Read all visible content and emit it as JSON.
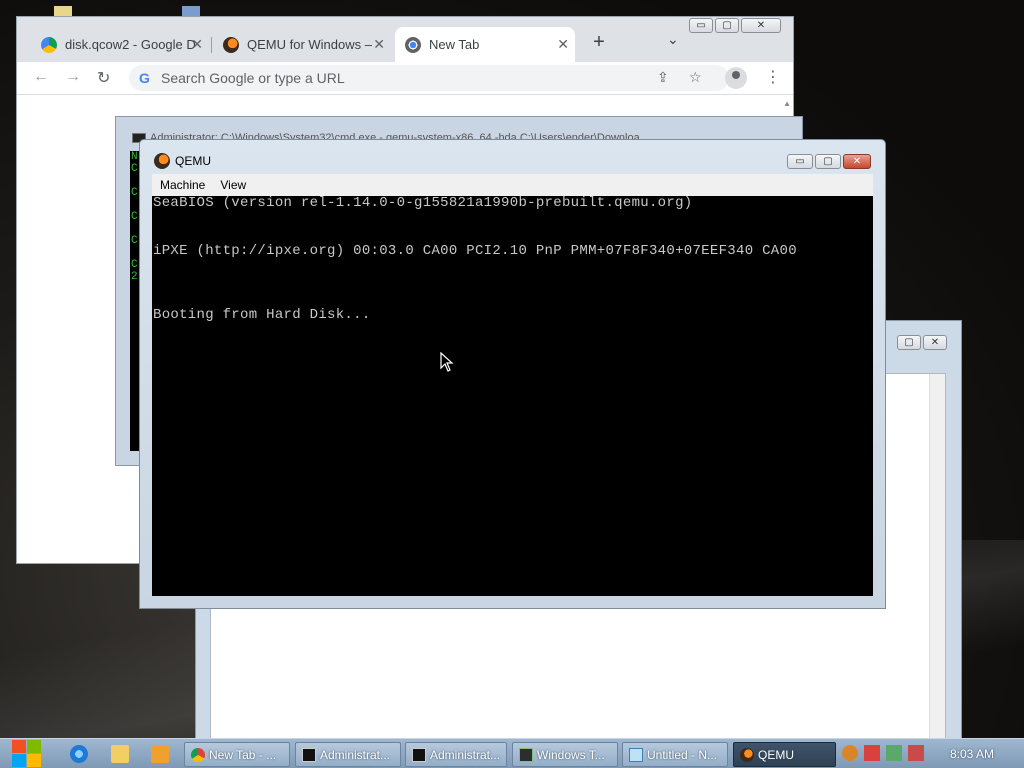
{
  "chrome": {
    "tabs": [
      {
        "label": "disk.qcow2 - Google D",
        "icon": "google-drive-icon",
        "close": "✕"
      },
      {
        "label": "QEMU for Windows –",
        "icon": "qemu-icon",
        "close": "✕"
      },
      {
        "label": "New Tab",
        "icon": "chrome-icon",
        "close": "✕",
        "active": true
      }
    ],
    "new_tab_glyph": "+",
    "tab_search_glyph": "⌄",
    "omnibox_placeholder": "Search Google or type a URL",
    "omnibox_badge": "G",
    "nav": {
      "back": "←",
      "forward": "→",
      "reload": "↻"
    },
    "share_glyph": "⇪",
    "bookmark_glyph": "☆",
    "menu_glyph": "⋮",
    "window_buttons": {
      "min": "▭",
      "max": "▢",
      "close": "✕"
    }
  },
  "cmd": {
    "title": "Administrator: C:\\Windows\\System32\\cmd.exe - qemu-system-x86_64 -hda C:\\Users\\ender\\Downloa",
    "visible_chars": [
      "N",
      "C",
      "",
      "C",
      "",
      "C",
      "",
      "C",
      "",
      "C",
      "2"
    ]
  },
  "qemu": {
    "title": "QEMU",
    "menu": [
      "Machine",
      "View"
    ],
    "screen_lines": [
      "SeaBIOS (version rel-1.14.0-0-g155821a1990b-prebuilt.qemu.org)",
      "iPXE (http://ipxe.org) 00:03.0 CA00 PCI2.10 PnP PMM+07F8F340+07EEF340 CA00",
      "Booting from Hard Disk..."
    ],
    "window_buttons": {
      "min": "▭",
      "max": "▢",
      "close": "✕"
    }
  },
  "notepad": {
    "window_buttons": {
      "max": "▢",
      "close": "✕"
    }
  },
  "taskbar": {
    "tasks": [
      {
        "label": "New Tab - ...",
        "icon": "chrome-icon"
      },
      {
        "label": "Administrat...",
        "icon": "cmd-icon"
      },
      {
        "label": "Administrat...",
        "icon": "cmd-icon"
      },
      {
        "label": "Windows T...",
        "icon": "terminal-icon"
      },
      {
        "label": "Untitled - N...",
        "icon": "notepad-icon"
      },
      {
        "label": "QEMU",
        "icon": "qemu-icon",
        "active": true
      }
    ],
    "clock": "8:03 AM"
  },
  "colors": {
    "accent_blue": "#4285f4",
    "qemu_close": "#c7462d",
    "terminal_green": "#3cba3c"
  }
}
